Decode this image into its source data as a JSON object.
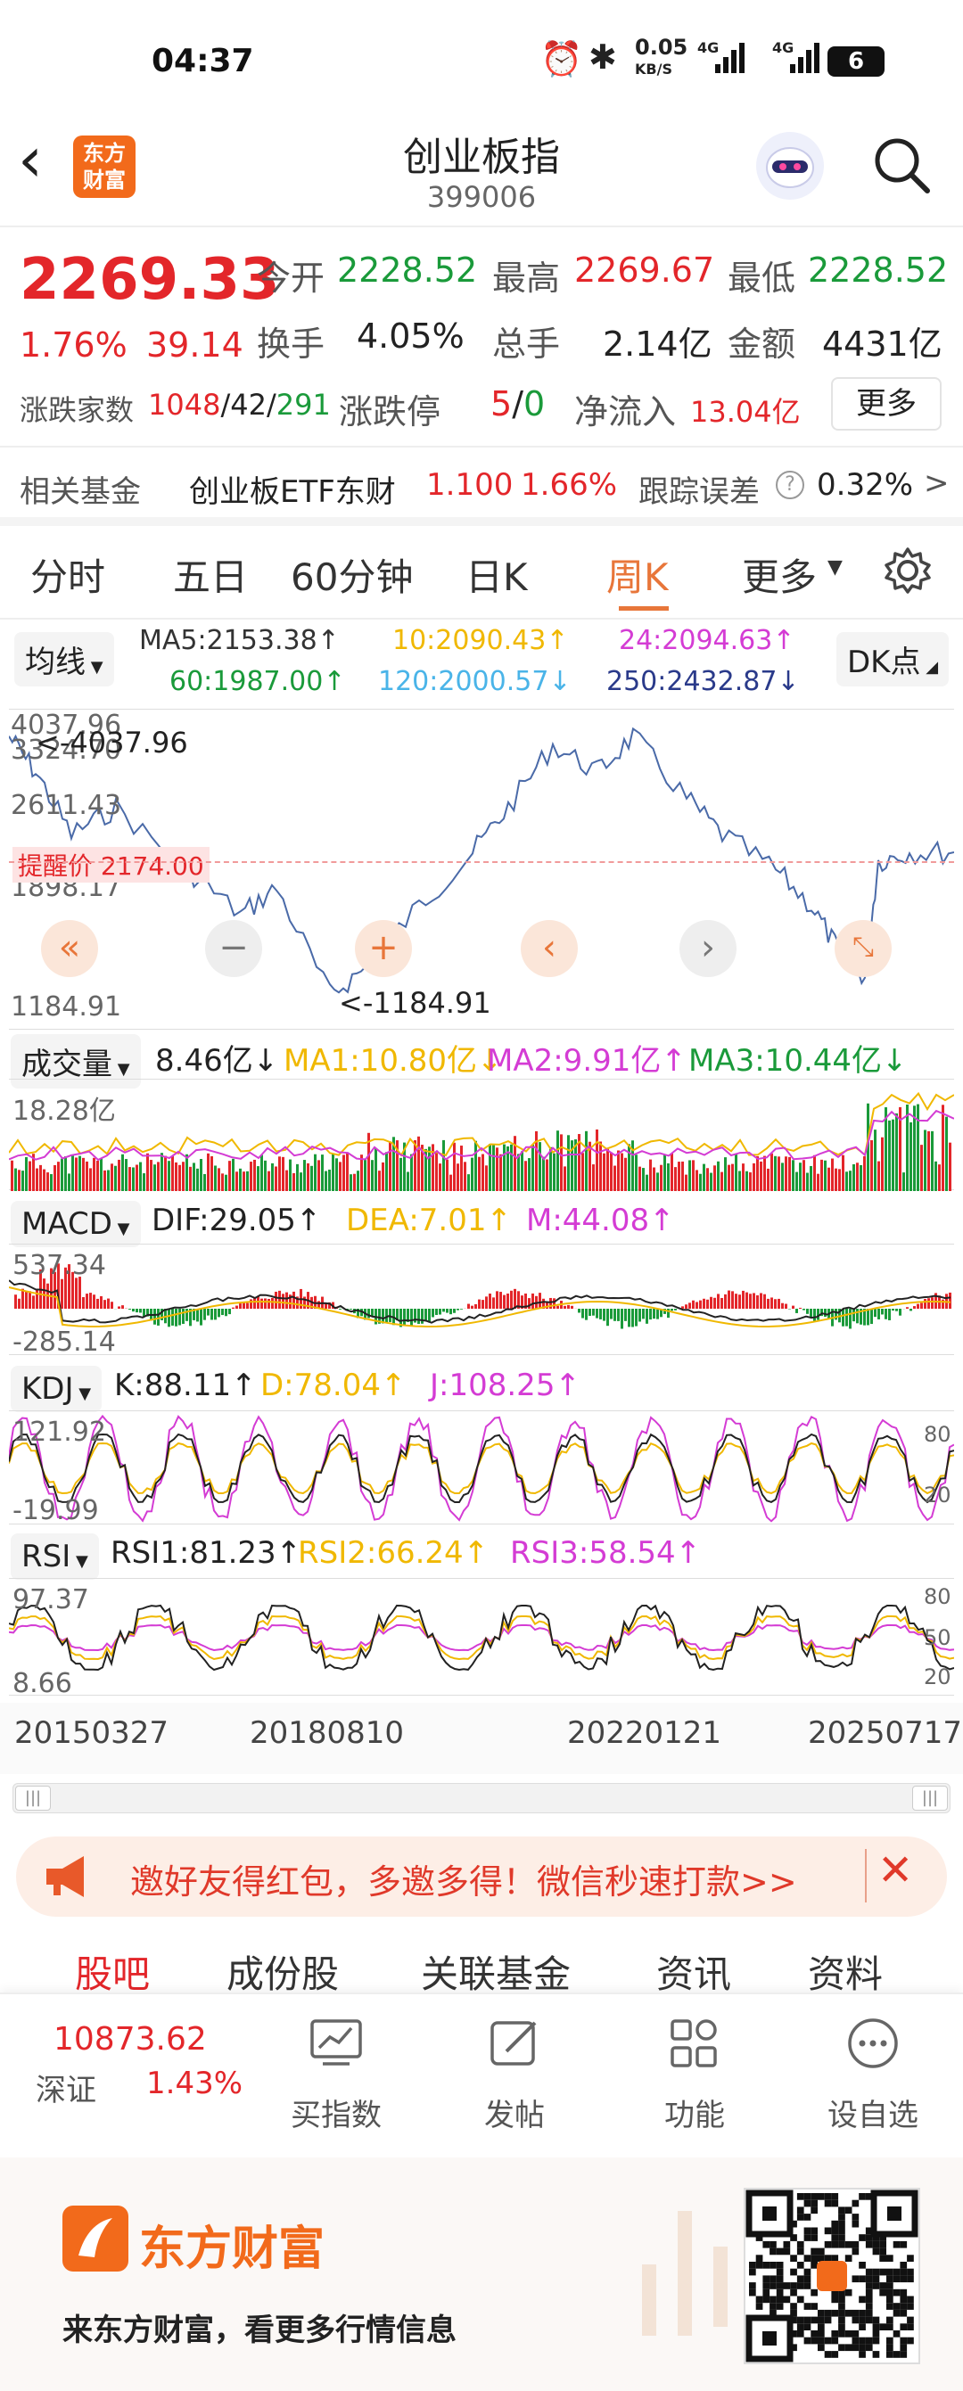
{
  "status": {
    "time": "04:37",
    "net": "0.05",
    "net_unit": "KB/S",
    "battery": "6",
    "sig1": "4G",
    "sig2": "4G"
  },
  "header": {
    "logo_line1": "东方",
    "logo_line2": "财富",
    "title": "创业板指",
    "code": "399006"
  },
  "quote": {
    "price": "2269.33",
    "change_pct": "1.76%",
    "change_abs": "39.14",
    "open_label": "今开",
    "open": "2228.52",
    "high_label": "最高",
    "high": "2269.67",
    "low_label": "最低",
    "low": "2228.52",
    "turn_label": "换手",
    "turn": "4.05%",
    "vol_label": "总手",
    "vol": "2.14亿",
    "amt_label": "金额",
    "amt": "4431亿",
    "adv_label": "涨跌家数",
    "adv_up": "1048",
    "adv_sep1": "/",
    "adv_flat": "42",
    "adv_sep2": "/",
    "adv_down": "291",
    "limit_label": "涨跌停",
    "limit_up": "5",
    "limit_sep": "/",
    "limit_down": "0",
    "inflow_label": "净流入",
    "inflow": "13.04亿",
    "more": "更多"
  },
  "fund": {
    "label": "相关基金",
    "name": "创业板ETF东财",
    "price": "1.100",
    "pct": "1.66%",
    "err_label": "跟踪误差",
    "err": "0.32%",
    "arrow": ">"
  },
  "tabs": [
    {
      "label": "分时"
    },
    {
      "label": "五日"
    },
    {
      "label": "60分钟"
    },
    {
      "label": "日K"
    },
    {
      "label": "周K"
    },
    {
      "label": "更多"
    }
  ],
  "ma": {
    "selector": "均线",
    "ma5": "MA5:2153.38↑",
    "ma10": "10:2090.43↑",
    "ma24": "24:2094.63↑",
    "ma60": "60:1987.00↑",
    "ma120": "120:2000.57↓",
    "ma250": "250:2432.87↓",
    "dk": "DK点"
  },
  "colors": {
    "red": "#e3262a",
    "green": "#1a9a3a",
    "orange": "#e8763a",
    "yellow": "#f0b800",
    "magenta": "#d43cd4",
    "cyan": "#4ab4e8",
    "navy": "#2a3a8a"
  },
  "kline": {
    "ytop": "4037.96",
    "y2": "3324.70",
    "y3": "2611.43",
    "y4": "1898.17",
    "ybottom": "1184.91",
    "max_label": "4037.96",
    "min_label": "1184.91",
    "warn": "提醒价 2174.00"
  },
  "volume": {
    "selector": "成交量",
    "val": "8.46亿↓",
    "ma1": "MA1:10.80亿↓",
    "ma2": "MA2:9.91亿↑",
    "ma3": "MA3:10.44亿↓",
    "ymax": "18.28亿"
  },
  "macd": {
    "selector": "MACD",
    "dif": "DIF:29.05↑",
    "dea": "DEA:7.01↑",
    "m": "M:44.08↑",
    "ytop": "537.34",
    "ybottom": "-285.14"
  },
  "kdj": {
    "selector": "KDJ",
    "k": "K:88.11↑",
    "d": "D:78.04↑",
    "j": "J:108.25↑",
    "ytop": "121.92",
    "ybottom": "-19.99",
    "r1": "80",
    "r2": "20"
  },
  "rsi": {
    "selector": "RSI",
    "r1": "RSI1:81.23↑",
    "r2": "RSI2:66.24↑",
    "r3": "RSI3:58.54↑",
    "ytop": "97.37",
    "ybottom": "8.66",
    "g1": "80",
    "g2": "50",
    "g3": "20"
  },
  "dates": [
    "20150327",
    "20180810",
    "20220121",
    "20250717"
  ],
  "banner": {
    "text": "邀好友得红包，多邀多得！微信秒速打款>>"
  },
  "lowtabs": [
    {
      "label": "股吧"
    },
    {
      "label": "成份股"
    },
    {
      "label": "关联基金"
    },
    {
      "label": "资讯"
    },
    {
      "label": "资料"
    }
  ],
  "bottom": {
    "idx_val": "10873.62",
    "idx_name": "深证",
    "idx_pct": "1.43%",
    "buy": "买指数",
    "post": "发帖",
    "func": "功能",
    "fav": "设自选"
  },
  "footer": {
    "brand": "东方财富",
    "slogan": "来东方财富，看更多行情信息"
  }
}
